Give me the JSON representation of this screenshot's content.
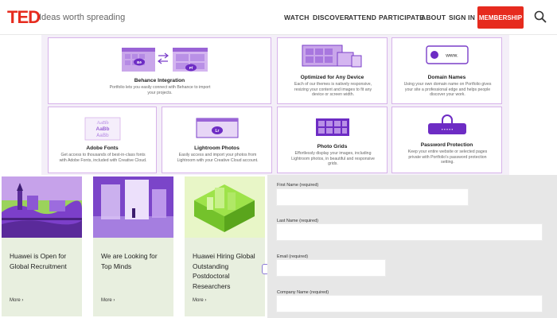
{
  "header": {
    "logo": "TED",
    "tagline": "Ideas worth spreading",
    "nav": [
      "WATCH",
      "DISCOVER",
      "ATTEND",
      "PARTICIPATE",
      "ABOUT",
      "SIGN IN"
    ],
    "membership": "MEMBERSHIP",
    "brand_color": "#e62b1e"
  },
  "features": [
    {
      "title": "Behance Integration",
      "desc": "Portfolio lets you easily connect with Behance to import your projects.",
      "icon": "behance-portfolio-icon",
      "badge_a": "Bē",
      "badge_b": "Pf"
    },
    {
      "title": "Optimized for Any Device",
      "desc": "Each of our themes is natively responsive, resizing your content and images to fit any device or screen width.",
      "icon": "devices-icon"
    },
    {
      "title": "Domain Names",
      "desc": "Using your own domain name on Portfolio gives your site a professional edge and helps people discover your work.",
      "icon": "domain-icon",
      "badge": "www."
    },
    {
      "title": "Adobe Fonts",
      "desc": "Get access to thousands of best-in-class fonts with Adobe Fonts, included with Creative Cloud.",
      "icon": "fonts-icon",
      "sample": "AaBb"
    },
    {
      "title": "Lightroom Photos",
      "desc": "Easily access and import your photos from Lightroom with your Creative Cloud account.",
      "icon": "lightroom-icon",
      "badge": "Lr"
    },
    {
      "title": "Photo Grids",
      "desc": "Effortlessly display your images, including Lightroom photos, in beautiful and responsive grids.",
      "icon": "grid-icon"
    },
    {
      "title": "Password Protection",
      "desc": "Keep your entire website or selected pages private with Portfolio's password protection setting.",
      "icon": "lock-icon",
      "dots": "• • • • •"
    }
  ],
  "jobs": [
    {
      "title": "Huawei is Open for Global Recruitment",
      "more": "More"
    },
    {
      "title": "We are Looking for Top Minds",
      "more": "More"
    },
    {
      "title": "Huawei Hiring Global Outstanding Postdoctoral Researchers",
      "more": "More"
    }
  ],
  "form": {
    "fields": [
      {
        "label": "First Name (required)"
      },
      {
        "label": "Last Name (required)"
      },
      {
        "label": "Email (required)"
      },
      {
        "label": "Company Name (required)"
      }
    ]
  }
}
